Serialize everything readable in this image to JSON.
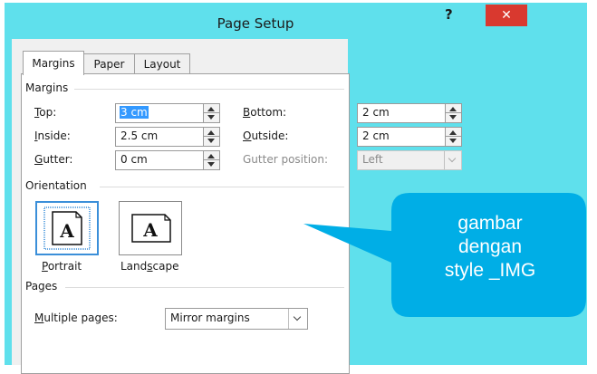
{
  "window": {
    "title": "Page Setup",
    "help_label": "?",
    "close_label": "✕",
    "frame_color": "#5fe0ec",
    "close_color": "#d9392f"
  },
  "tabs": [
    {
      "label": "Margins",
      "active": true
    },
    {
      "label": "Paper",
      "active": false
    },
    {
      "label": "Layout",
      "active": false
    }
  ],
  "margins": {
    "section_title": "Margins",
    "top": {
      "label_u": "T",
      "label_rest": "op:",
      "value": "3 cm"
    },
    "bottom": {
      "label_u": "B",
      "label_rest": "ottom:",
      "value": "2 cm"
    },
    "inside": {
      "label_u": "I",
      "label_rest": "nside:",
      "value": "2.5 cm"
    },
    "outside": {
      "label_u": "O",
      "label_rest": "utside:",
      "value": "2 cm"
    },
    "gutter": {
      "label_u": "G",
      "label_rest": "utter:",
      "value": "0 cm"
    },
    "gutter_position": {
      "label": "Gutter position:",
      "value": "Left"
    }
  },
  "orientation": {
    "section_title": "Orientation",
    "portrait": {
      "label_pre": "",
      "label_u": "P",
      "label_post": "ortrait",
      "glyph": "A"
    },
    "landscape": {
      "label_pre": "Land",
      "label_u": "s",
      "label_post": "cape",
      "glyph": "A"
    }
  },
  "pages": {
    "section_title": "Pages",
    "multiple_pages": {
      "label_u": "M",
      "label_rest": "ultiple pages:",
      "value": "Mirror margins"
    }
  },
  "callout": {
    "lines": [
      "gambar",
      "dengan",
      "style _IMG"
    ],
    "color": "#00aee6"
  }
}
